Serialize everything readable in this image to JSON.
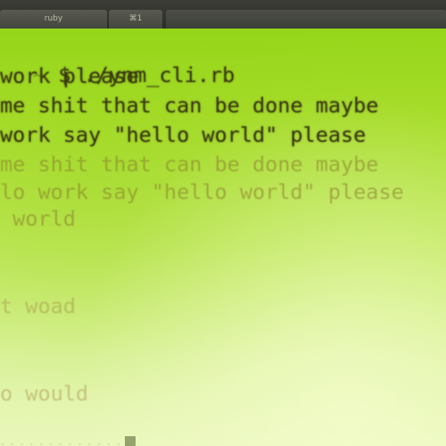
{
  "tabs": [
    {
      "label": "ruby"
    },
    {
      "label": "⌘1"
    },
    {
      "label": ""
    }
  ],
  "terminal": {
    "prompt_prefix": "~ ",
    "command_line": "$ ./ynm_cli.rb",
    "lines": [
      "work please",
      "me shit that can be done maybe",
      "work say \"hello world\" please",
      "me shit that can be done maybe",
      "lo work say \"hello world\" please",
      " world",
      "",
      "",
      "t woad",
      "",
      "",
      "o would"
    ],
    "bottom_hint": "- - - - - - - - - - - - - -"
  },
  "colors": {
    "screen_green": "#a6dc2a",
    "text_dark": "#3b3a12",
    "tab_bar": "#2a2c27"
  }
}
